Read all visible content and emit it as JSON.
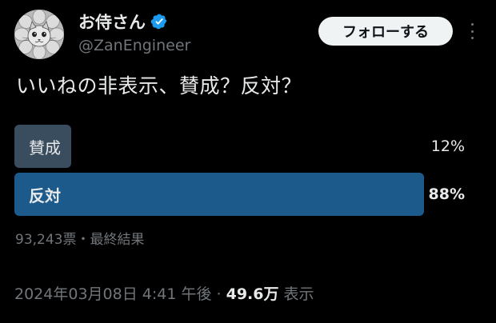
{
  "author": {
    "display_name": "お侍さん",
    "handle": "@ZanEngineer",
    "verified_color": "#1d9bf0"
  },
  "header": {
    "follow_label": "フォローする",
    "more_icon": "more-dots-vertical-icon"
  },
  "tweet": {
    "text": "いいねの非表示、賛成？反対？"
  },
  "poll": {
    "options": [
      {
        "label": "賛成",
        "percent_text": "12%",
        "fraction": 0.12,
        "winner": false,
        "color": "#3a4d5e"
      },
      {
        "label": "反対",
        "percent_text": "88%",
        "fraction": 0.88,
        "winner": true,
        "color": "#1d5a8c"
      }
    ],
    "meta_text": "93,243票・最終結果"
  },
  "footer": {
    "datetime": "2024年03月08日 4:41 午後",
    "separator": "·",
    "views_count": "49.6万",
    "views_label": "表示"
  }
}
